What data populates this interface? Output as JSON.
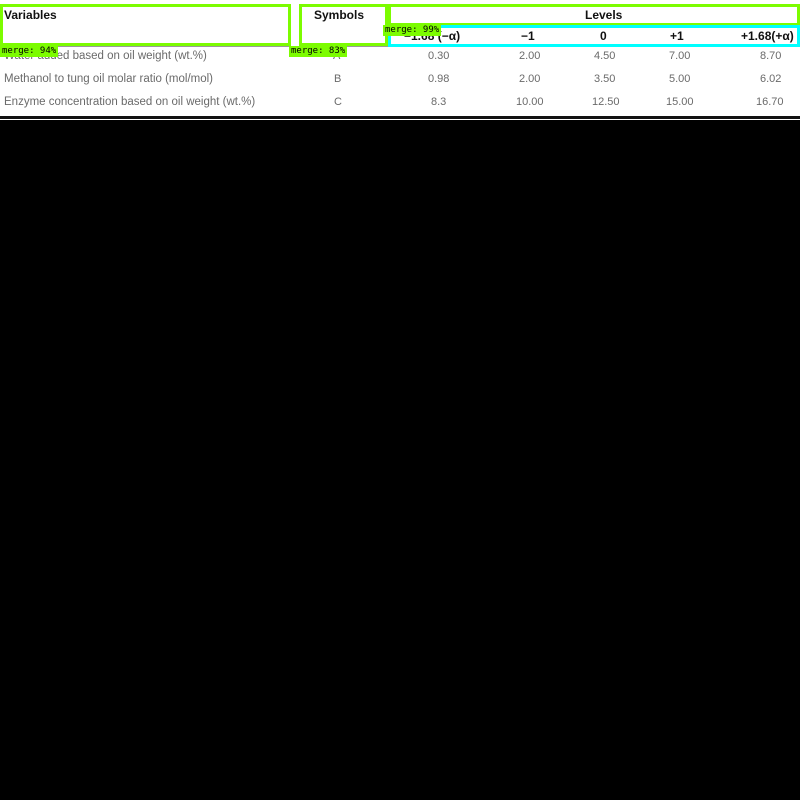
{
  "table": {
    "headers": {
      "variables": "Variables",
      "symbols": "Symbols",
      "levels": "Levels"
    },
    "level_labels": [
      "−1.68 (−α)",
      "−1",
      "0",
      "+1",
      "+1.68(+α)"
    ],
    "rows": [
      {
        "variable": "Water added based on oil weight (wt.%)",
        "symbol": "A",
        "values": [
          "0.30",
          "2.00",
          "4.50",
          "7.00",
          "8.70"
        ]
      },
      {
        "variable": "Methanol to tung oil molar ratio (mol/mol)",
        "symbol": "B",
        "values": [
          "0.98",
          "2.00",
          "3.50",
          "5.00",
          "6.02"
        ]
      },
      {
        "variable": "Enzyme concentration based on oil weight (wt.%)",
        "symbol": "C",
        "values": [
          "8.3",
          "10.00",
          "12.50",
          "15.00",
          "16.70"
        ]
      }
    ]
  },
  "overlays": {
    "tag_merge_99": "merge: 99%",
    "tag_merge_94": "merge: 94%",
    "tag_merge_83": "merge: 83%",
    "colors": {
      "green": "#7cfc00",
      "cyan": "#00ffff"
    }
  }
}
